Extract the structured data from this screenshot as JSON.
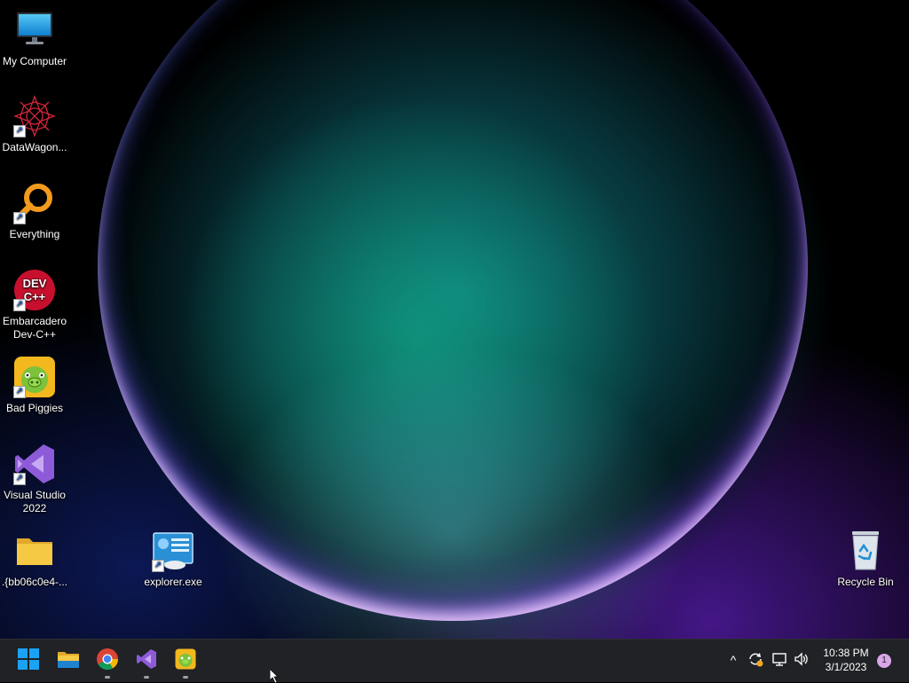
{
  "desktop": {
    "icons": [
      {
        "label": "My Computer",
        "icon": "monitor-icon"
      },
      {
        "label": "DataWagon...",
        "icon": "datawagon-icon"
      },
      {
        "label": "Everything",
        "icon": "magnifier-icon"
      },
      {
        "label": "Embarcadero Dev-C++",
        "icon": "devcpp-icon",
        "badge": "DEV C++"
      },
      {
        "label": "Bad Piggies",
        "icon": "pig-icon"
      },
      {
        "label": "Visual Studio 2022",
        "icon": "visual-studio-icon"
      },
      {
        "label": ".{bb06c0e4-...",
        "icon": "folder-icon"
      },
      {
        "label": "explorer.exe",
        "icon": "explorer-exe-icon"
      },
      {
        "label": "Recycle Bin",
        "icon": "recycle-bin-icon"
      }
    ]
  },
  "taskbar": {
    "pinned": [
      {
        "name": "start",
        "icon": "windows-logo-icon"
      },
      {
        "name": "file-explorer",
        "icon": "folder-icon"
      },
      {
        "name": "chrome",
        "icon": "chrome-icon"
      },
      {
        "name": "visual-studio",
        "icon": "visual-studio-icon"
      },
      {
        "name": "bad-piggies",
        "icon": "pig-icon"
      }
    ],
    "tray": {
      "chevron": "^",
      "time": "10:38 PM",
      "date": "3/1/2023",
      "notification_count": "1"
    }
  },
  "colors": {
    "taskbar_bg": "#202226",
    "windows_blue": "#1aa3f5",
    "folder_yellow": "#f6c944",
    "vs_purple": "#8e5bd8",
    "notif_badge": "#d9a6e8"
  }
}
